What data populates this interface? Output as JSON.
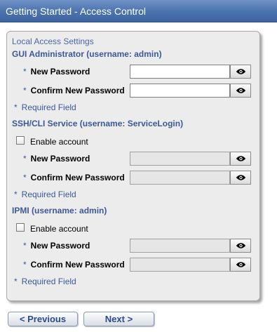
{
  "title": "Getting Started - Access Control",
  "section_caption": "Local Access Settings",
  "required_star": "*",
  "groups": {
    "gui": {
      "title": "GUI Administrator (username: admin)",
      "new_password_label": "New Password",
      "confirm_password_label": "Confirm New Password",
      "required_note": "Required Field"
    },
    "ssh": {
      "title": "SSH/CLI Service (username: ServiceLogin)",
      "enable_label": "Enable account",
      "new_password_label": "New Password",
      "confirm_password_label": "Confirm New Password",
      "required_note": "Required Field"
    },
    "ipmi": {
      "title": "IPMI (username: admin)",
      "enable_label": "Enable account",
      "new_password_label": "New Password",
      "confirm_password_label": "Confirm New Password",
      "required_note": "Required Field"
    }
  },
  "buttons": {
    "previous": "< Previous",
    "next": "Next >"
  },
  "icons": {
    "reveal": "eye-icon"
  },
  "colors": {
    "titlebar": "#4a72ad",
    "label_blue": "#3b5998",
    "panel_bg": "#ececec"
  }
}
